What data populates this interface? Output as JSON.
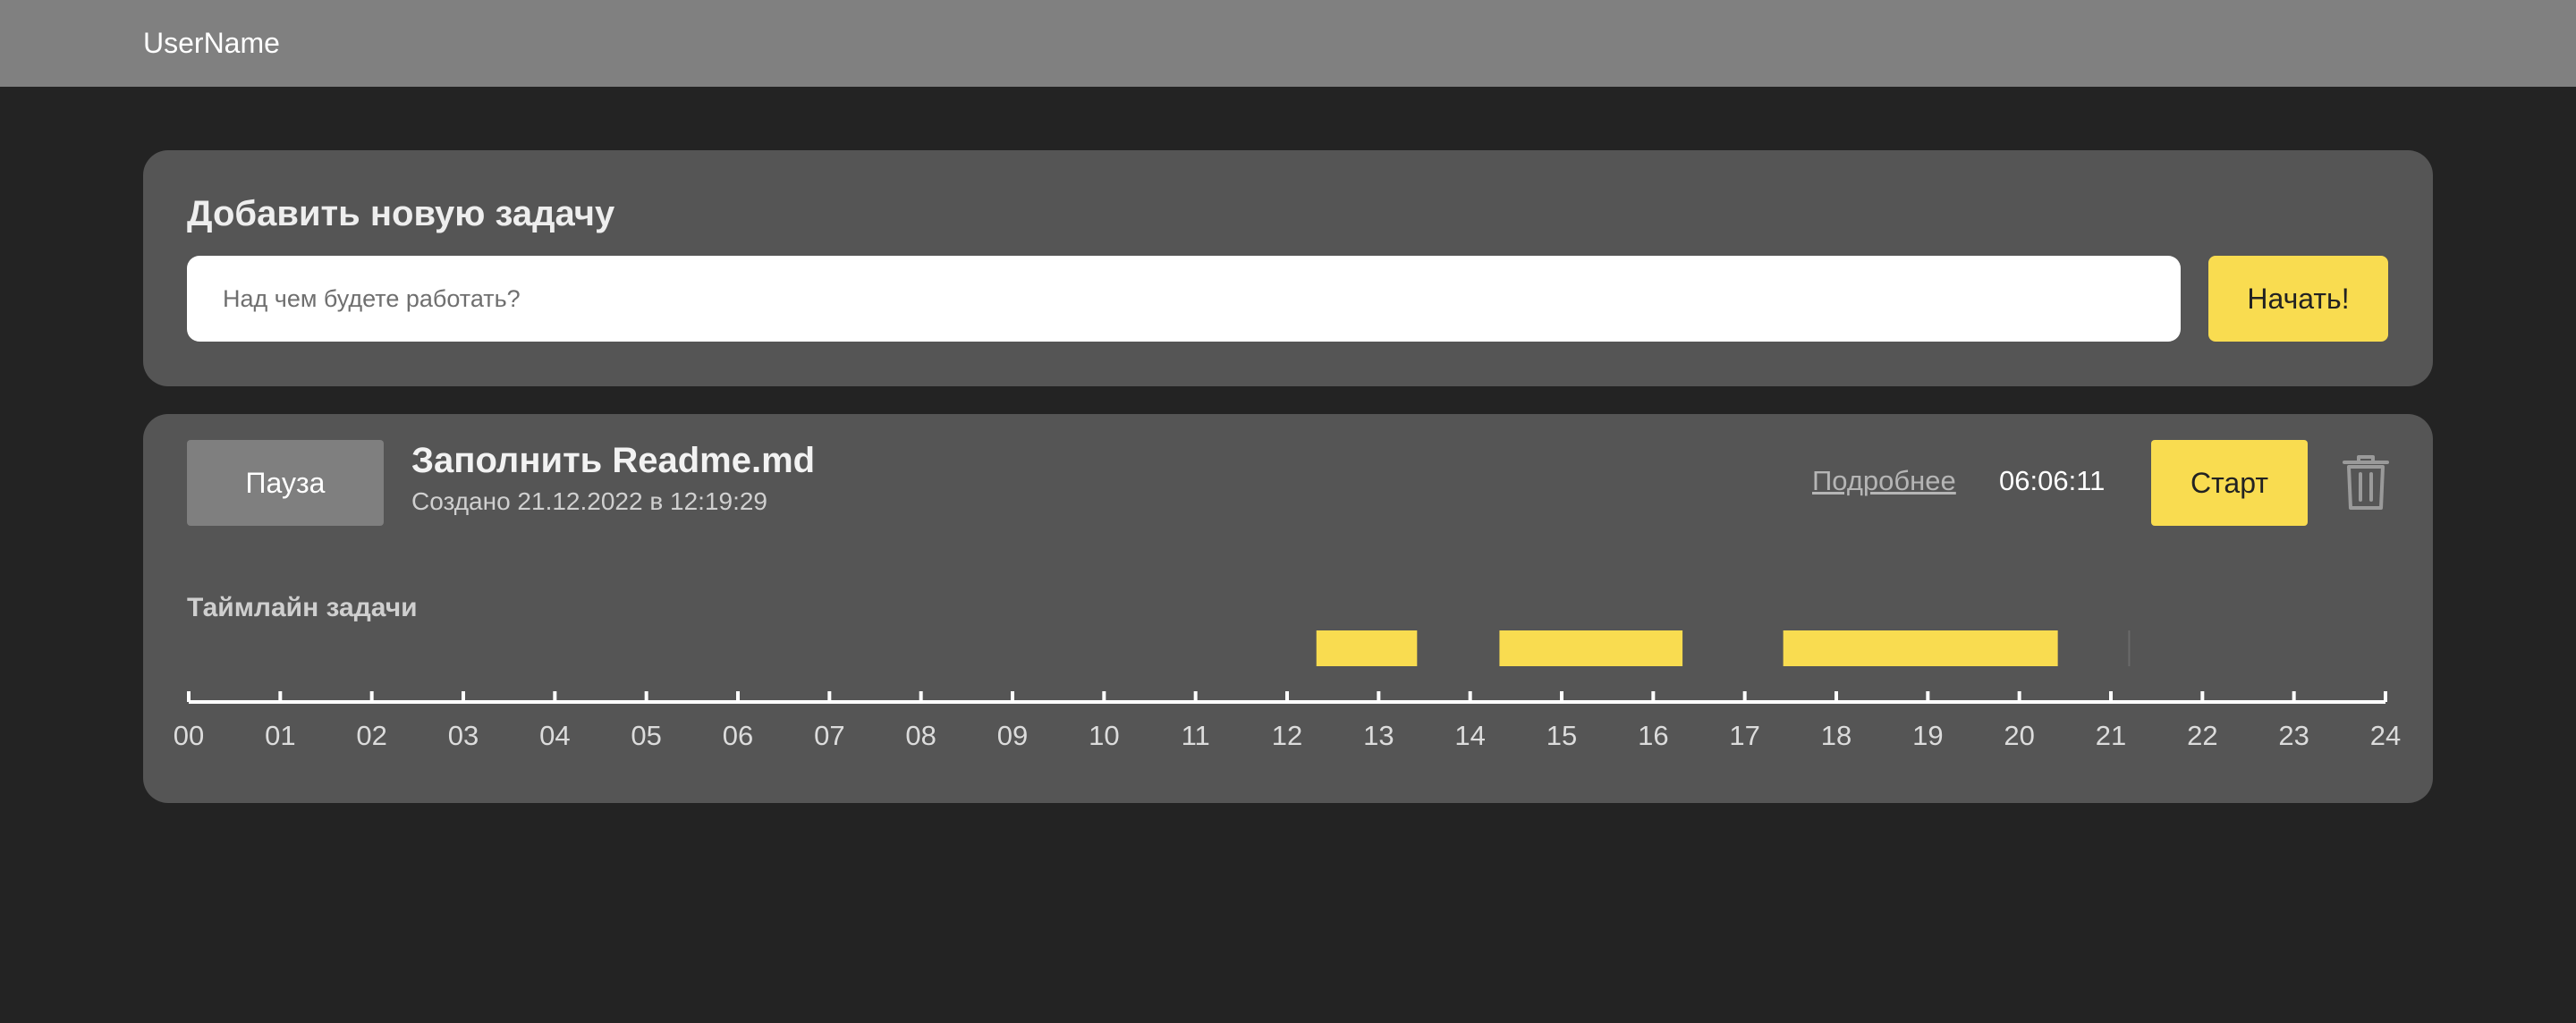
{
  "header": {
    "username": "UserName"
  },
  "add_task": {
    "title": "Добавить новую задачу",
    "input_placeholder": "Над чем будете работать?",
    "input_value": "",
    "start_button_label": "Начать!"
  },
  "task": {
    "pause_button_label": "Пауза",
    "name": "Заполнить Readme.md",
    "created": "Создано 21.12.2022 в 12:19:29",
    "details_link": "Подробнее",
    "elapsed": "06:06:11",
    "start_button_label": "Старт",
    "delete_icon": "trash-icon"
  },
  "timeline": {
    "title": "Таймлайн задачи",
    "hour_labels": [
      "00",
      "01",
      "02",
      "03",
      "04",
      "05",
      "06",
      "07",
      "08",
      "09",
      "10",
      "11",
      "12",
      "13",
      "14",
      "15",
      "16",
      "17",
      "18",
      "19",
      "20",
      "21",
      "22",
      "23",
      "24"
    ],
    "segments_hours": [
      [
        12.32,
        13.42
      ],
      [
        14.32,
        16.32
      ],
      [
        17.42,
        20.42
      ]
    ],
    "marker_hour": 21.2
  },
  "colors": {
    "background": "#232323",
    "topbar": "#808080",
    "card": "#555555",
    "accent": "#f9dc50",
    "pause_button": "#7f7f7f"
  }
}
